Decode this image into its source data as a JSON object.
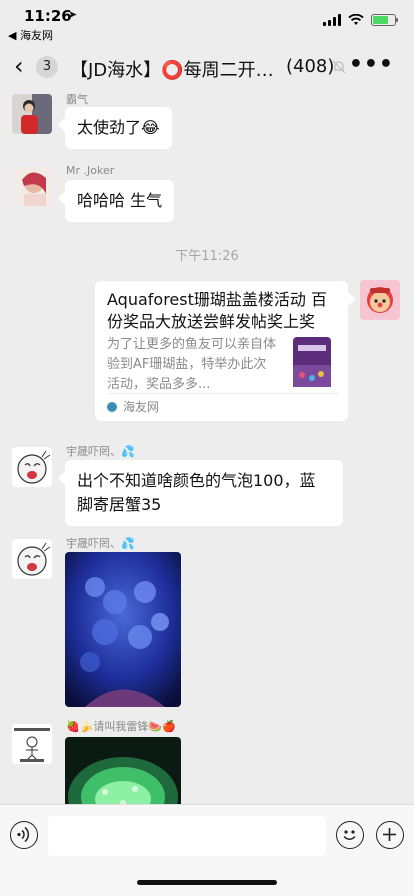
{
  "status_bar": {
    "time": "11:26",
    "back_to_app": "◀ 海友网",
    "battery_level": 0.7
  },
  "nav": {
    "back_count": "3",
    "title": "【JD海水】⭕每周二开…",
    "member_count": "(408)"
  },
  "messages": [
    {
      "sender": "霸气",
      "text": "太使劲了😂"
    },
    {
      "sender": "Mr .Joker",
      "text": "哈哈哈 生气"
    }
  ],
  "timestamp": "下午11:26",
  "link_card": {
    "title": "Aquaforest珊瑚盐盖楼活动 百份奖品大放送尝鲜发帖奖上奖",
    "description": "为了让更多的鱼友可以亲自体验到AF珊瑚盐，特举办此次活动，奖品多多...",
    "source": "海友网"
  },
  "later_messages": [
    {
      "sender": "宇晟吓罔、💦",
      "text": "出个不知道啥颜色的气泡100，蓝脚寄居蟹35"
    },
    {
      "sender": "宇晟吓罔、💦"
    },
    {
      "sender": "🍓🍌请叫我雷锋🍉🍎"
    }
  ],
  "colors": {
    "background": "#ededed",
    "bubble": "#ffffff",
    "battery": "#4cd964"
  }
}
